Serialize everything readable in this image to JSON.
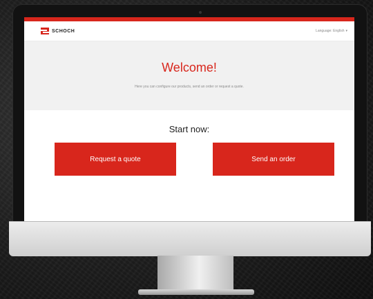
{
  "header": {
    "logo_text": "SCHOCH",
    "language_label": "Language: English",
    "language_caret": "▾"
  },
  "hero": {
    "title": "Welcome!",
    "subtitle": "Here you can configure our products, send an order or request a quote."
  },
  "main": {
    "start_label": "Start now:",
    "buttons": {
      "quote": "Request a quote",
      "order": "Send an order"
    }
  },
  "colors": {
    "accent": "#d8261c",
    "hero_bg": "#f1f1f1"
  }
}
